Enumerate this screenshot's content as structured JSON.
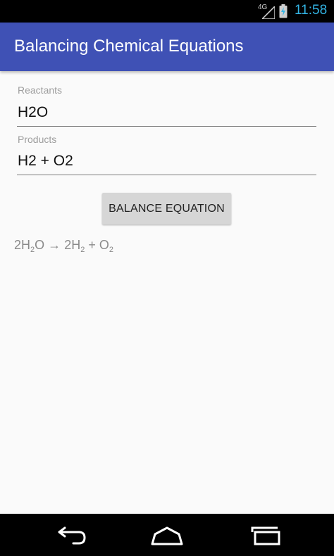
{
  "status_bar": {
    "network": "4G",
    "time": "11:58",
    "signal_icon": "signal-icon",
    "battery_icon": "battery-charging-icon",
    "time_color": "#33b5e5"
  },
  "app_bar": {
    "title": "Balancing Chemical Equations",
    "color": "#3f51b5"
  },
  "form": {
    "reactants_label": "Reactants",
    "reactants_value": "H2O",
    "products_label": "Products",
    "products_value": "H2 + O2",
    "button_label": "BALANCE EQUATION"
  },
  "result": {
    "r1_coef": "2",
    "r1_a": "H",
    "r1_sub": "2",
    "r1_b": "O",
    "arrow": "→",
    "p1_coef": "2",
    "p1_a": "H",
    "p1_sub": "2",
    "plus": "+",
    "p2_a": "O",
    "p2_sub": "2"
  },
  "nav_bar": {
    "back_icon": "back-icon",
    "home_icon": "home-icon",
    "recents_icon": "recent-apps-icon"
  }
}
